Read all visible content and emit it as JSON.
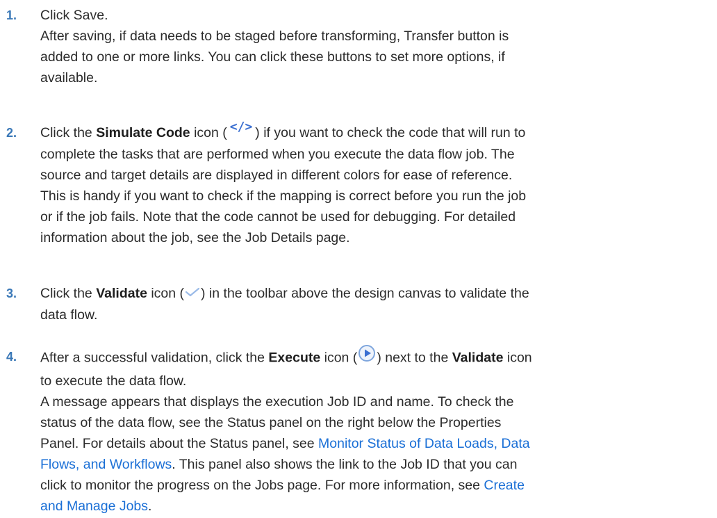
{
  "steps": [
    {
      "num": "1.",
      "lines": [
        "Click Save.",
        "After saving, if data needs to be staged before transforming, Transfer button is",
        "added to one or more links. You can click these buttons to set more options, if",
        "available."
      ]
    },
    {
      "num": "2.",
      "l1_before": "Click the ",
      "l1_bold": "Simulate Code",
      "l1_mid": " icon (",
      "l1_icon": "code-icon",
      "l1_after": ") if you want to check the code that will run to",
      "lines": [
        "complete the tasks that are performed when you execute the data flow job. The",
        "source and target details are displayed in different colors for ease of reference.",
        "This is handy if you want to check if the mapping is correct before you run the job",
        "or if the job fails. Note that the code cannot be used for debugging. For detailed",
        "information about the job, see the Job Details page."
      ]
    },
    {
      "num": "3.",
      "l1_before": "Click the ",
      "l1_bold": "Validate",
      "l1_mid": " icon (",
      "l1_icon": "checkmark-icon",
      "l1_after": ") in the toolbar above the design canvas to validate the",
      "lines": [
        "data flow."
      ]
    },
    {
      "num": "4.",
      "l1_before": "After a successful validation, click the ",
      "l1_bold": "Execute",
      "l1_mid": " icon (",
      "l1_icon": "play-circle-icon",
      "l1_after": ") next to the ",
      "l1_bold2": "Validate",
      "l1_end": " icon",
      "line2": "to execute the data flow.",
      "line3": "A message appears that displays the execution Job ID and name. To check the",
      "line4": "status of the data flow, see the Status panel on the right below the Properties",
      "line5_before": "Panel. For details about the Status panel, see ",
      "line5_link": "Monitor Status of Data Loads, Data",
      "line6_link": "Flows, and Workflows",
      "line6_after": ". This panel also shows the link to the Job ID that you can",
      "line7_before": "click to monitor the progress on the Jobs page. For more information, see ",
      "line7_link": "Create",
      "line8_link": "and Manage Jobs",
      "line8_after": "."
    }
  ],
  "colors": {
    "step_number": "#3a78b7",
    "link": "#1a6fd6",
    "text": "#2b2b2b",
    "icon_blue": "#3b6fd1"
  }
}
